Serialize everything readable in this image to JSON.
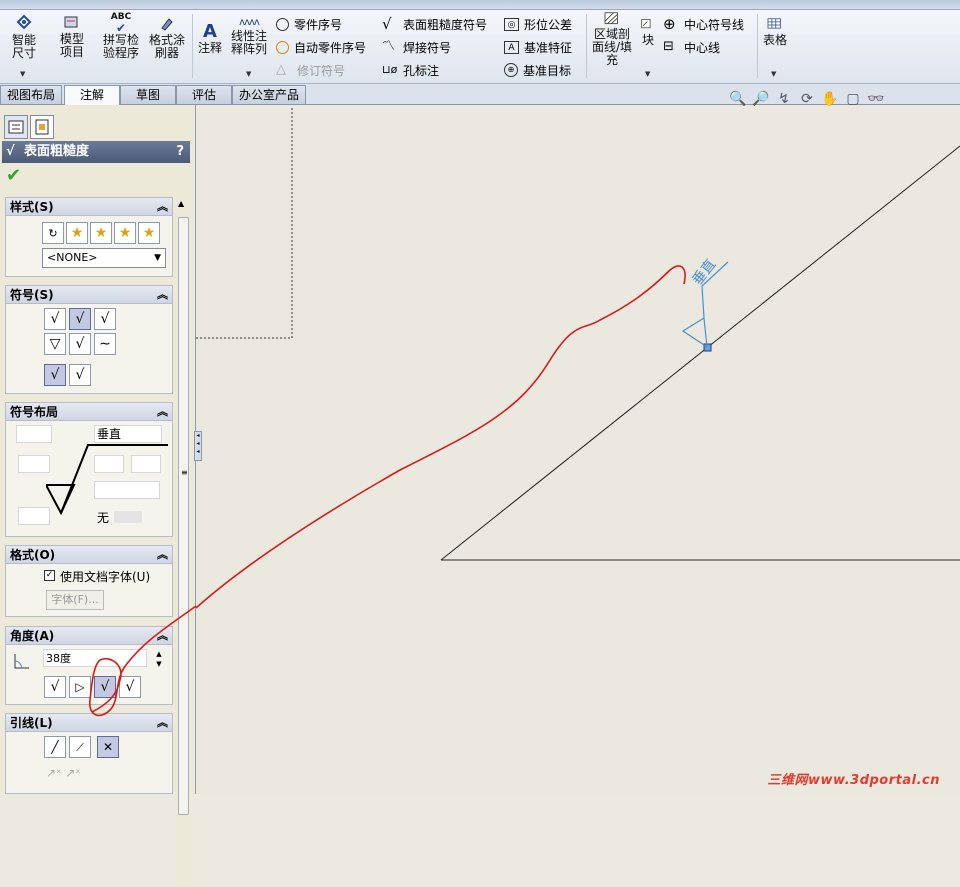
{
  "ribbon": {
    "smart_dimension": "智能尺寸",
    "model_items": "模型项目",
    "spell_check": "拼写检验程序",
    "format_painter": "格式涂刷器",
    "note": "注释",
    "linear_pattern": "线性注释阵列",
    "balloon": "零件序号",
    "auto_balloon": "自动零件序号",
    "revision_symbol": "修订符号",
    "surface_finish": "表面粗糙度符号",
    "weld_symbol": "焊接符号",
    "hole_callout": "孔标注",
    "gtol": "形位公差",
    "datum_feature": "基准特征",
    "datum_target": "基准目标",
    "area_hatch": "区域剖面线/填充",
    "block": "块",
    "center_mark": "中心符号线",
    "centerline": "中心线",
    "table": "表格",
    "abc_label": "ABC"
  },
  "tabs": [
    {
      "label": "视图布局"
    },
    {
      "label": "注解"
    },
    {
      "label": "草图"
    },
    {
      "label": "评估"
    },
    {
      "label": "办公室产品"
    }
  ],
  "panel": {
    "title": "表面粗糙度",
    "help": "?",
    "style": {
      "header": "样式(S)",
      "combo_value": "<NONE>"
    },
    "symbol": {
      "header": "符号(S)"
    },
    "layout": {
      "header": "符号布局",
      "direction_value": "垂直",
      "none_label": "无"
    },
    "format": {
      "header": "格式(O)",
      "use_doc_font": "使用文档字体(U)",
      "use_doc_font_checked": true,
      "font_button": "字体(F)..."
    },
    "angle": {
      "header": "角度(A)",
      "value": "38度"
    },
    "leader": {
      "header": "引线(L)"
    }
  },
  "canvas": {
    "annotation_text": "垂直"
  },
  "watermark": "三维网www.3dportal.cn",
  "colors": {
    "annotation_blue": "#4a8fd8",
    "markup_red": "#d81b1b",
    "panel_title": "#5a6987"
  }
}
